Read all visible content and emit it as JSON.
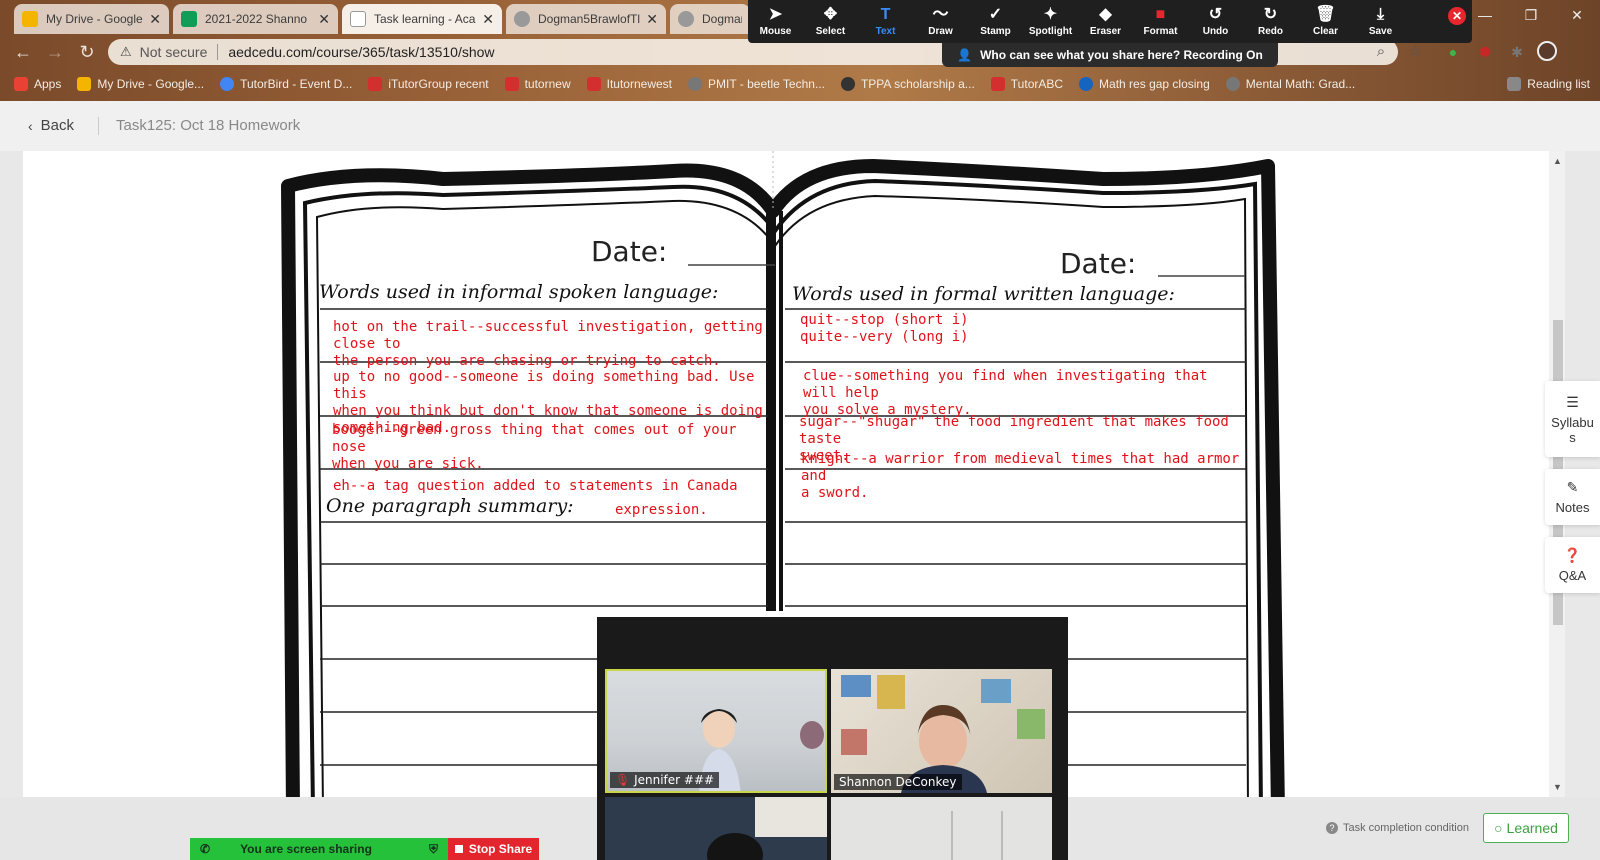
{
  "browser": {
    "tabs": [
      {
        "title": "My Drive - Google",
        "color": "#f4b400"
      },
      {
        "title": "2021-2022 Shanno",
        "color": "#0f9d58"
      },
      {
        "title": "Task learning - Aca",
        "color": "#ffffff"
      },
      {
        "title": "Dogman5BrawlofTl",
        "color": "#999999"
      },
      {
        "title": "Dogman",
        "color": "#999999"
      }
    ],
    "address": {
      "security": "Not secure",
      "url": "aedcedu.com/course/365/task/13510/show"
    },
    "bookmarks": [
      {
        "label": "Apps",
        "color": "#e94235"
      },
      {
        "label": "My Drive - Google...",
        "color": "#f4b400"
      },
      {
        "label": "TutorBird - Event D...",
        "color": "#4285f4"
      },
      {
        "label": "iTutorGroup recent",
        "color": "#d32f2f"
      },
      {
        "label": "tutornew",
        "color": "#d32f2f"
      },
      {
        "label": "Itutornewest",
        "color": "#d32f2f"
      },
      {
        "label": "PMIT - beetle Techn...",
        "color": "#777777"
      },
      {
        "label": "TPPA scholarship a...",
        "color": "#333333"
      },
      {
        "label": "TutorABC",
        "color": "#d32f2f"
      },
      {
        "label": "Math res gap closing",
        "color": "#1565c0"
      },
      {
        "label": "Mental Math: Grad...",
        "color": "#777777"
      },
      {
        "label": "Reading list",
        "color": "#888888"
      }
    ]
  },
  "zoom_toolbar": {
    "tools": [
      {
        "label": "Mouse",
        "icon": "cursor-icon",
        "glyph": "➤"
      },
      {
        "label": "Select",
        "icon": "select-icon",
        "glyph": "✥"
      },
      {
        "label": "Text",
        "icon": "text-icon",
        "glyph": "T"
      },
      {
        "label": "Draw",
        "icon": "draw-icon",
        "glyph": "〜"
      },
      {
        "label": "Stamp",
        "icon": "stamp-icon",
        "glyph": "✓"
      },
      {
        "label": "Spotlight",
        "icon": "spotlight-icon",
        "glyph": "✦"
      },
      {
        "label": "Eraser",
        "icon": "eraser-icon",
        "glyph": "◆"
      },
      {
        "label": "Format",
        "icon": "format-icon",
        "glyph": "■"
      },
      {
        "label": "Undo",
        "icon": "undo-icon",
        "glyph": "↺"
      },
      {
        "label": "Redo",
        "icon": "redo-icon",
        "glyph": "↻"
      },
      {
        "label": "Clear",
        "icon": "trash-icon",
        "glyph": "🗑"
      },
      {
        "label": "Save",
        "icon": "save-icon",
        "glyph": "⤓"
      }
    ],
    "active_tool": "Text",
    "active_color": "#3b8cf5",
    "format_color": "#e8262d",
    "banner": "Who can see what you share here? Recording On"
  },
  "page": {
    "back_label": "Back",
    "task_title": "Task125:  Oct 18 Homework"
  },
  "worksheet": {
    "date_label": "Date:",
    "left_heading": "Words used in informal spoken language:",
    "right_heading": "Words used in formal written language:",
    "summary_heading": "One paragraph summary:",
    "annotation_color": "#e0131a",
    "left_entries": [
      "hot on the trail--successful investigation, getting close to\nthe person you are chasing or trying to catch.",
      "up to no good--someone is doing something bad. Use this\nwhen you think but don't know that someone is doing\nsomething bad.",
      "booger--green gross thing that comes out of your nose\nwhen you are sick.",
      "eh--a tag question added to statements in Canada",
      "expression."
    ],
    "right_entries": [
      "quit--stop  (short i)\nquite--very (long i)",
      "clue--something you find when investigating that will help\nyou solve a mystery.",
      "sugar--\"shugar\" the food ingredient that makes food taste\nsweet.",
      "knight--a warrior from medieval times that had armor and\na sword."
    ]
  },
  "side_panel": [
    {
      "label": "Syllabus",
      "icon": "list-icon"
    },
    {
      "label": "Notes",
      "icon": "pencil-icon"
    },
    {
      "label": "Q&A",
      "icon": "question-icon"
    }
  ],
  "footer": {
    "task_condition": "Task completion condition",
    "learned_label": "Learned",
    "share_status": "You are screen sharing",
    "stop_share": "Stop Share"
  },
  "video": {
    "participants": [
      {
        "name": "Jennifer ###",
        "muted": true
      },
      {
        "name": "Shannon DeConkey",
        "muted": false
      }
    ]
  }
}
